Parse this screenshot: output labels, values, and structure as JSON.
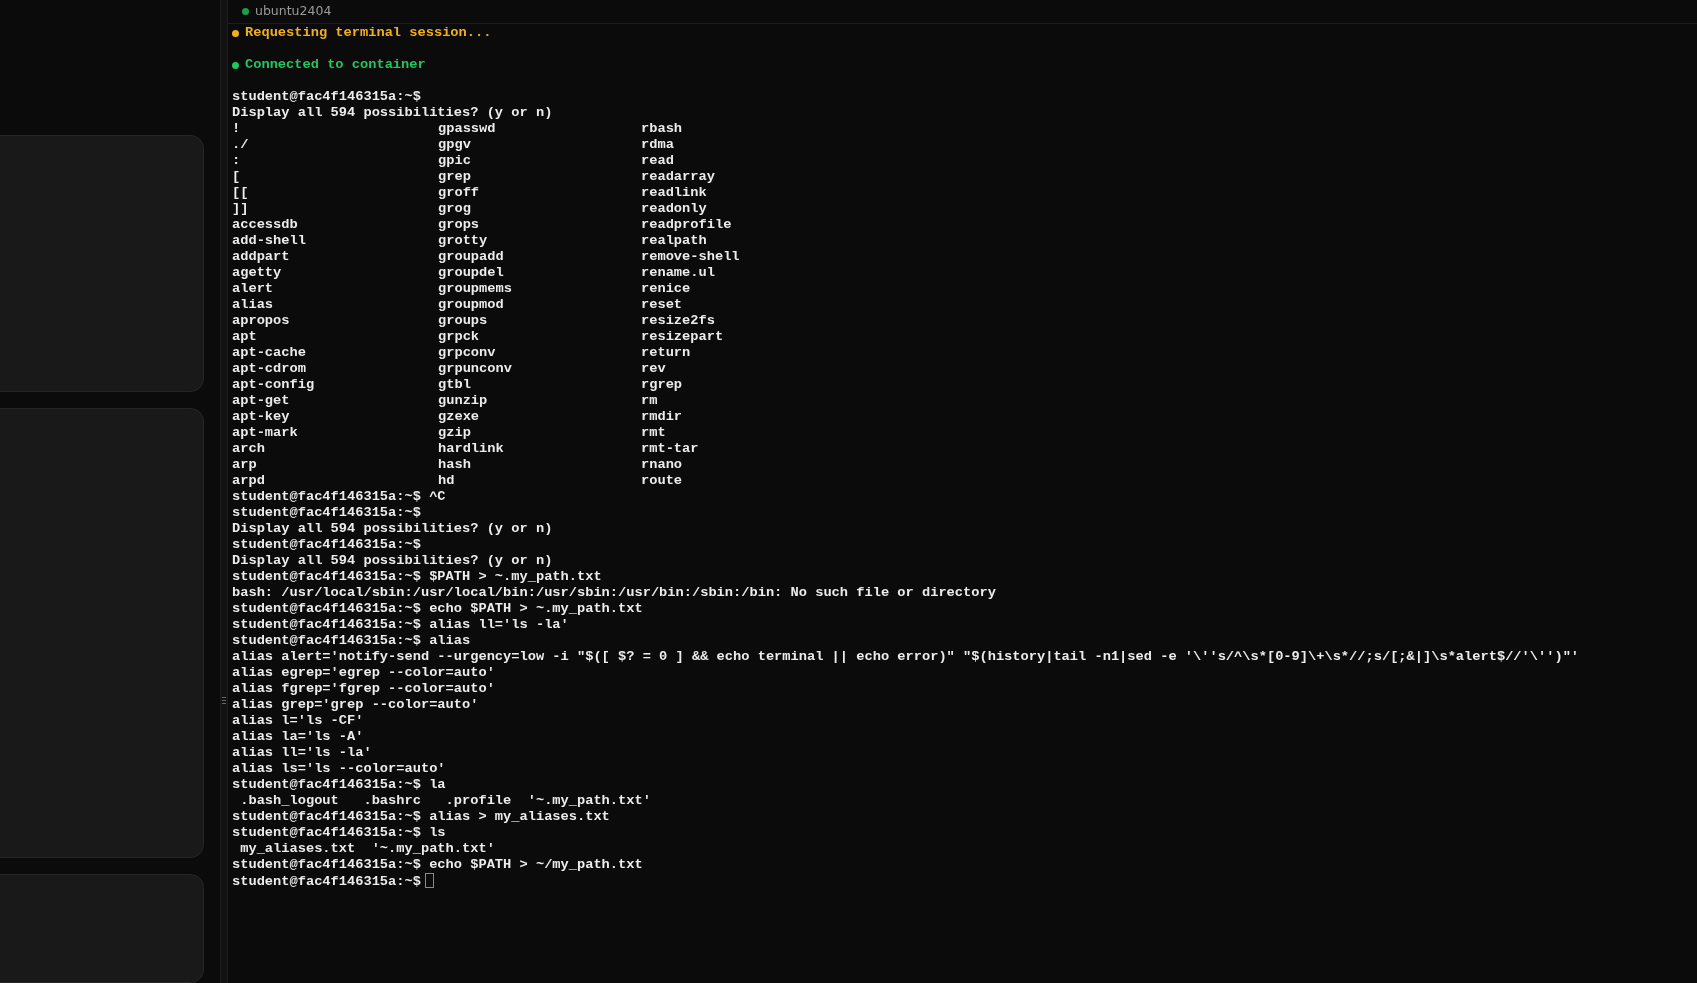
{
  "tab": {
    "label": "ubuntu2404",
    "connected": true
  },
  "status_messages": [
    {
      "kind": "pending",
      "text": "Requesting terminal session..."
    },
    {
      "kind": "success",
      "text": "Connected to container"
    }
  ],
  "terminal": {
    "cursor_visible": true,
    "lines": [
      {
        "kind": "text",
        "text": "student@fac4f146315a:~$"
      },
      {
        "kind": "text",
        "text": "Display all 594 possibilities? (y or n)"
      },
      {
        "kind": "columns",
        "cells": [
          "!",
          "gpasswd",
          "rbash"
        ]
      },
      {
        "kind": "columns",
        "cells": [
          "./",
          "gpgv",
          "rdma"
        ]
      },
      {
        "kind": "columns",
        "cells": [
          ":",
          "gpic",
          "read"
        ]
      },
      {
        "kind": "columns",
        "cells": [
          "[",
          "grep",
          "readarray"
        ]
      },
      {
        "kind": "columns",
        "cells": [
          "[[",
          "groff",
          "readlink"
        ]
      },
      {
        "kind": "columns",
        "cells": [
          "]]",
          "grog",
          "readonly"
        ]
      },
      {
        "kind": "columns",
        "cells": [
          "accessdb",
          "grops",
          "readprofile"
        ]
      },
      {
        "kind": "columns",
        "cells": [
          "add-shell",
          "grotty",
          "realpath"
        ]
      },
      {
        "kind": "columns",
        "cells": [
          "addpart",
          "groupadd",
          "remove-shell"
        ]
      },
      {
        "kind": "columns",
        "cells": [
          "agetty",
          "groupdel",
          "rename.ul"
        ]
      },
      {
        "kind": "columns",
        "cells": [
          "alert",
          "groupmems",
          "renice"
        ]
      },
      {
        "kind": "columns",
        "cells": [
          "alias",
          "groupmod",
          "reset"
        ]
      },
      {
        "kind": "columns",
        "cells": [
          "apropos",
          "groups",
          "resize2fs"
        ]
      },
      {
        "kind": "columns",
        "cells": [
          "apt",
          "grpck",
          "resizepart"
        ]
      },
      {
        "kind": "columns",
        "cells": [
          "apt-cache",
          "grpconv",
          "return"
        ]
      },
      {
        "kind": "columns",
        "cells": [
          "apt-cdrom",
          "grpunconv",
          "rev"
        ]
      },
      {
        "kind": "columns",
        "cells": [
          "apt-config",
          "gtbl",
          "rgrep"
        ]
      },
      {
        "kind": "columns",
        "cells": [
          "apt-get",
          "gunzip",
          "rm"
        ]
      },
      {
        "kind": "columns",
        "cells": [
          "apt-key",
          "gzexe",
          "rmdir"
        ]
      },
      {
        "kind": "columns",
        "cells": [
          "apt-mark",
          "gzip",
          "rmt"
        ]
      },
      {
        "kind": "columns",
        "cells": [
          "arch",
          "hardlink",
          "rmt-tar"
        ]
      },
      {
        "kind": "columns",
        "cells": [
          "arp",
          "hash",
          "rnano"
        ]
      },
      {
        "kind": "columns",
        "cells": [
          "arpd",
          "hd",
          "route"
        ]
      },
      {
        "kind": "text",
        "text": "student@fac4f146315a:~$ ^C"
      },
      {
        "kind": "text",
        "text": "student@fac4f146315a:~$"
      },
      {
        "kind": "text",
        "text": "Display all 594 possibilities? (y or n)"
      },
      {
        "kind": "text",
        "text": "student@fac4f146315a:~$"
      },
      {
        "kind": "text",
        "text": "Display all 594 possibilities? (y or n)"
      },
      {
        "kind": "text",
        "text": "student@fac4f146315a:~$ $PATH > ~.my_path.txt"
      },
      {
        "kind": "text",
        "text": "bash: /usr/local/sbin:/usr/local/bin:/usr/sbin:/usr/bin:/sbin:/bin: No such file or directory"
      },
      {
        "kind": "text",
        "text": "student@fac4f146315a:~$ echo $PATH > ~.my_path.txt"
      },
      {
        "kind": "text",
        "text": "student@fac4f146315a:~$ alias ll='ls -la'"
      },
      {
        "kind": "text",
        "text": "student@fac4f146315a:~$ alias"
      },
      {
        "kind": "text",
        "text": "alias alert='notify-send --urgency=low -i \"$([ $? = 0 ] && echo terminal || echo error)\" \"$(history|tail -n1|sed -e '\\''s/^\\s*[0-9]\\+\\s*//;s/[;&|]\\s*alert$//'\\'')\"'"
      },
      {
        "kind": "text",
        "text": "alias egrep='egrep --color=auto'"
      },
      {
        "kind": "text",
        "text": "alias fgrep='fgrep --color=auto'"
      },
      {
        "kind": "text",
        "text": "alias grep='grep --color=auto'"
      },
      {
        "kind": "text",
        "text": "alias l='ls -CF'"
      },
      {
        "kind": "text",
        "text": "alias la='ls -A'"
      },
      {
        "kind": "text",
        "text": "alias ll='ls -la'"
      },
      {
        "kind": "text",
        "text": "alias ls='ls --color=auto'"
      },
      {
        "kind": "text",
        "text": "student@fac4f146315a:~$ la"
      },
      {
        "kind": "text",
        "text": " .bash_logout   .bashrc   .profile  '~.my_path.txt'"
      },
      {
        "kind": "text",
        "text": "student@fac4f146315a:~$ alias > my_aliases.txt"
      },
      {
        "kind": "text",
        "text": "student@fac4f146315a:~$ ls"
      },
      {
        "kind": "text",
        "text": " my_aliases.txt  '~.my_path.txt'"
      },
      {
        "kind": "text",
        "text": "student@fac4f146315a:~$ echo $PATH > ~/my_path.txt"
      },
      {
        "kind": "text",
        "text": "student@fac4f146315a:~$"
      }
    ]
  }
}
